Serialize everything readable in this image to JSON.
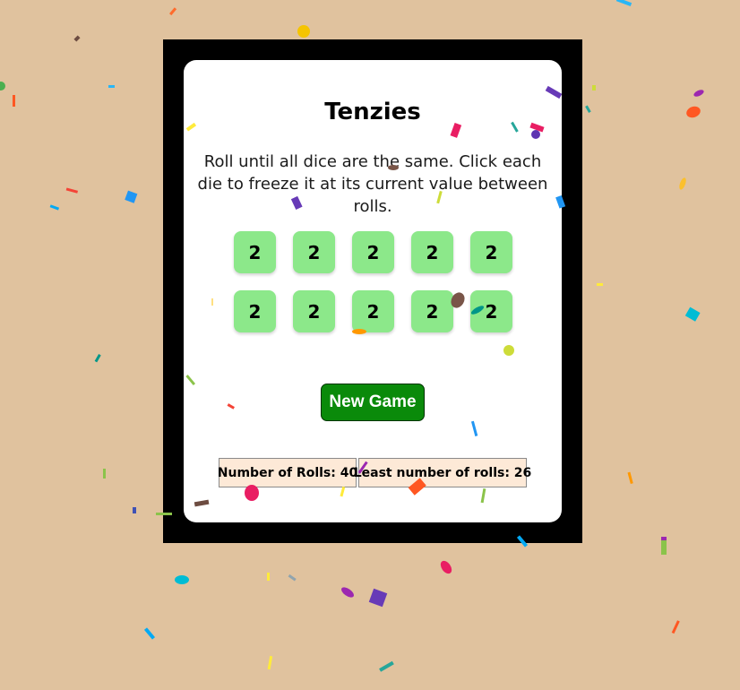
{
  "game": {
    "title": "Tenzies",
    "instructions": "Roll until all dice are the same. Click each die to freeze it at its current value between rolls.",
    "dice": [
      {
        "value": "2",
        "held": true
      },
      {
        "value": "2",
        "held": true
      },
      {
        "value": "2",
        "held": true
      },
      {
        "value": "2",
        "held": true
      },
      {
        "value": "2",
        "held": true
      },
      {
        "value": "2",
        "held": true
      },
      {
        "value": "2",
        "held": true
      },
      {
        "value": "2",
        "held": true
      },
      {
        "value": "2",
        "held": true
      },
      {
        "value": "2",
        "held": true
      }
    ],
    "button_label": "New Game"
  },
  "stats": {
    "rolls_label": "Number of Rolls: 40",
    "least_label": "Least number of rolls: 26"
  },
  "colors": {
    "background": "#e0c29e",
    "frame": "#000000",
    "card": "#ffffff",
    "die_held": "#8ce88a",
    "button": "#0a8a0a",
    "stat_bg": "#fde9d7"
  }
}
